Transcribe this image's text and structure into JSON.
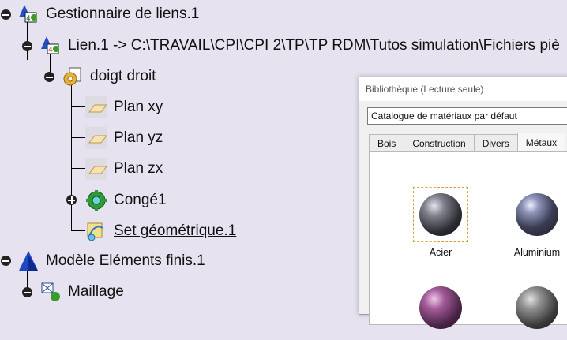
{
  "tree": {
    "root": {
      "label": "Gestionnaire de liens.1",
      "icon": "link-manager-icon"
    },
    "link": {
      "label": "Lien.1 -> C:\\TRAVAIL\\CPI\\CPI 2\\TP\\TP RDM\\Tutos simulation\\Fichiers piè",
      "icon": "link-icon"
    },
    "part": {
      "label": "doigt droit",
      "icon": "part-icon"
    },
    "planes": [
      {
        "label": "Plan xy",
        "icon": "plane-icon"
      },
      {
        "label": "Plan yz",
        "icon": "plane-icon"
      },
      {
        "label": "Plan zx",
        "icon": "plane-icon"
      }
    ],
    "fillet": {
      "label": "Congé1",
      "icon": "fillet-icon"
    },
    "geoset": {
      "label": "Set géométrique.1",
      "icon": "geometrical-set-icon"
    },
    "fem": {
      "label": "Modèle Eléments finis.1",
      "icon": "fem-model-icon"
    },
    "mesh": {
      "label": "Maillage",
      "icon": "mesh-icon"
    }
  },
  "dialog": {
    "title": "Bibliothèque (Lecture seule)",
    "catalog": "Catalogue de matériaux par défaut",
    "tabs": [
      "Bois",
      "Construction",
      "Divers",
      "Métaux"
    ],
    "active_tab": "Métaux",
    "materials": [
      {
        "name": "Acier",
        "selected": true
      },
      {
        "name": "Aluminium",
        "selected": false
      },
      {
        "name": "",
        "selected": false
      },
      {
        "name": "",
        "selected": false
      }
    ]
  }
}
